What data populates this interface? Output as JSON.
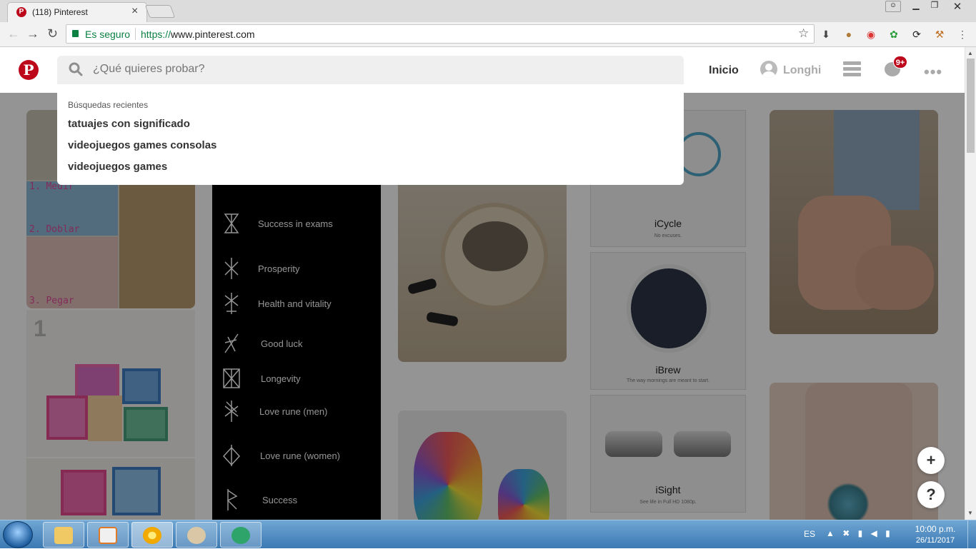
{
  "browser": {
    "tab_title": "(118) Pinterest",
    "tab_favicon": "P",
    "secure_label": "Es seguro",
    "url_protocol": "https://",
    "url_host": "www.pinterest.com"
  },
  "header": {
    "logo": "P",
    "search_placeholder": "¿Qué quieres probar?",
    "home_label": "Inicio",
    "user_name": "Longhi",
    "notifications_badge": "9+"
  },
  "dropdown": {
    "heading": "Búsquedas recientes",
    "items": [
      "tatuajes con significado",
      "videojuegos games consolas",
      "videojuegos games"
    ]
  },
  "feed": {
    "diy_steps": [
      "1. Medir",
      "2. Doblar",
      "3. Pegar"
    ],
    "diy_number": "1",
    "runes": [
      "Success in exams",
      "Prosperity",
      "Health and vitality",
      "Good luck",
      "Longevity",
      "Love rune (men)",
      "Love rune (women)",
      "Success"
    ],
    "apple_products": [
      {
        "name": "iCycle",
        "tagline": "No excuses."
      },
      {
        "name": "iBrew",
        "tagline": "The way mornings are meant to start."
      },
      {
        "name": "iSight",
        "tagline": "See life in Full HD 1080p."
      }
    ]
  },
  "fabs": {
    "add": "+",
    "help": "?"
  },
  "taskbar": {
    "lang": "ES",
    "time": "10:00 p.m.",
    "date": "26/11/2017"
  }
}
